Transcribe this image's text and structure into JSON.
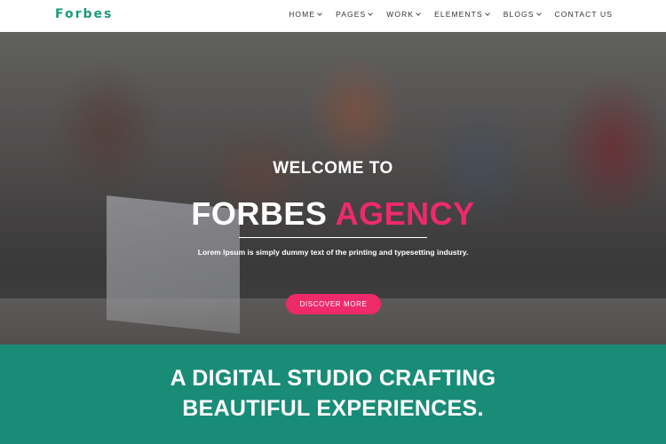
{
  "brand": {
    "logo": "Forbes"
  },
  "nav": {
    "items": [
      {
        "label": "HOME",
        "dropdown": true
      },
      {
        "label": "PAGES",
        "dropdown": true
      },
      {
        "label": "WORK",
        "dropdown": true
      },
      {
        "label": "ELEMENTS",
        "dropdown": true
      },
      {
        "label": "BLOGS",
        "dropdown": true
      },
      {
        "label": "CONTACT US",
        "dropdown": false
      }
    ]
  },
  "hero": {
    "welcome": "WELCOME TO",
    "title_main": "FORBES",
    "title_accent": "AGENCY",
    "subtitle": "Lorem Ipsum is simply dummy text of the printing and typesetting industry.",
    "cta_label": "DISCOVER MORE"
  },
  "studio": {
    "line1": "A DIGITAL STUDIO CRAFTING",
    "line2": "BEAUTIFUL EXPERIENCES."
  },
  "colors": {
    "brand_green": "#198c78",
    "accent_pink": "#ee2a6b",
    "logo_green": "#1a9a7c"
  },
  "icons": {
    "dropdown": "chevron-down-icon"
  }
}
